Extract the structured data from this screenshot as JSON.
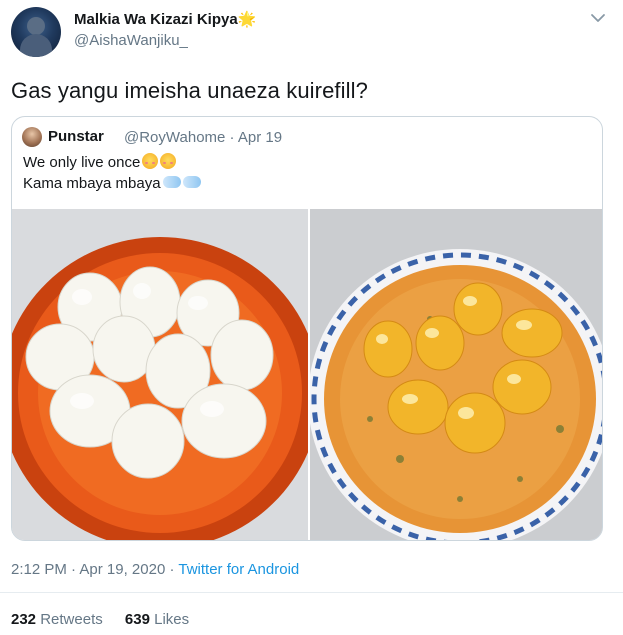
{
  "author": {
    "display_name": "Malkia Wa Kizazi Kipya",
    "handle": "@AishaWanjiku_",
    "badge_emoji": "🌟"
  },
  "tweet": {
    "text": "Gas yangu imeisha unaeza kuirefill?",
    "time": "2:12 PM",
    "date": "Apr 19, 2020",
    "source": "Twitter for Android",
    "separator": " · "
  },
  "quoted": {
    "display_name": "Punstar",
    "handle": "@RoyWahome",
    "date": "· Apr 19",
    "line1": "We only live once",
    "line2": "Kama mbaya mbaya"
  },
  "stats": {
    "retweets_count": "232",
    "retweets_label": "Retweets",
    "likes_count": "639",
    "likes_label": "Likes"
  },
  "colors": {
    "link": "#1b95e0",
    "secondary_text": "#657786",
    "border": "#ccd6dd"
  },
  "icons": {
    "menu": "chevron-down-icon",
    "emoji_1": "smiling-blush-emoji",
    "emoji_2": "dash-emoji"
  }
}
